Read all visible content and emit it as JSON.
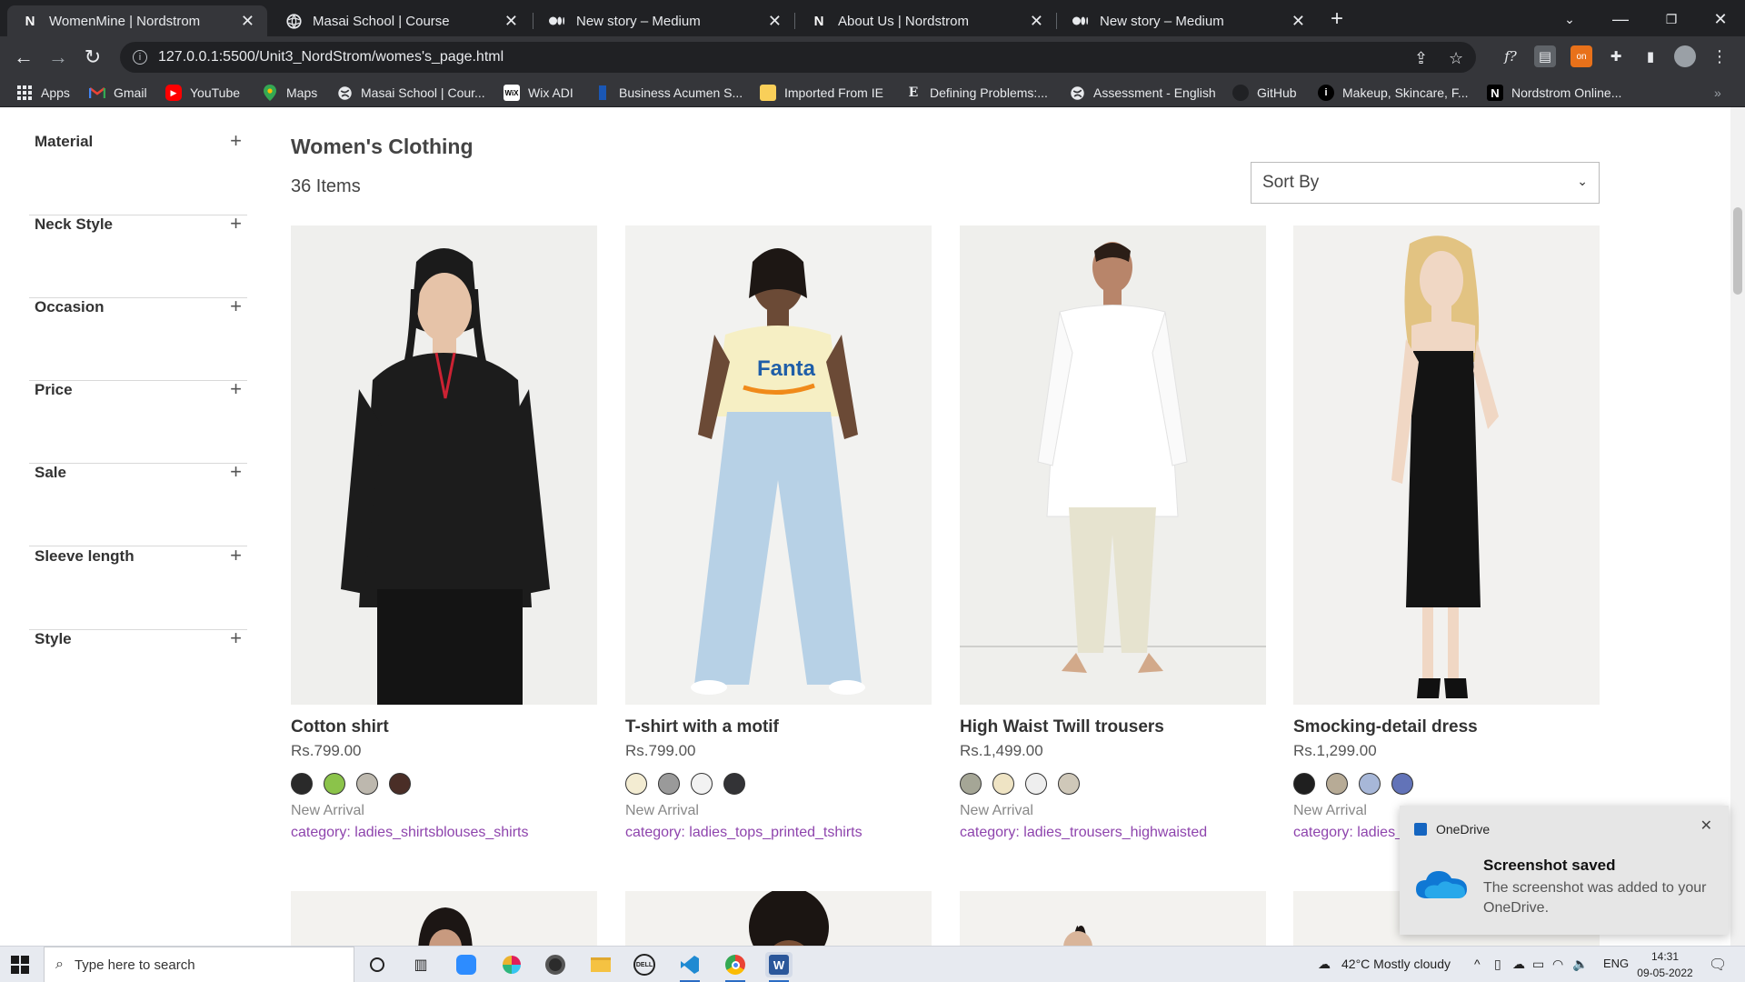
{
  "tabs": [
    {
      "title": "WomenMine | Nordstrom",
      "favicon": "N",
      "active": true
    },
    {
      "title": "Masai School | Course",
      "favicon": "globe"
    },
    {
      "title": "New story – Medium",
      "favicon": "medium"
    },
    {
      "title": "About Us | Nordstrom",
      "favicon": "N"
    },
    {
      "title": "New story – Medium",
      "favicon": "medium"
    }
  ],
  "address_bar": {
    "url": "127.0.0.1:5500/Unit3_NordStrom/womes's_page.html"
  },
  "bookmarks": [
    {
      "label": "Apps",
      "icon": "apps-grid-icon"
    },
    {
      "label": "Gmail",
      "icon": "gmail-icon"
    },
    {
      "label": "YouTube",
      "icon": "youtube-icon"
    },
    {
      "label": "Maps",
      "icon": "maps-icon"
    },
    {
      "label": "Masai School | Cour...",
      "icon": "globe-icon"
    },
    {
      "label": "Wix ADI",
      "icon": "wix-icon"
    },
    {
      "label": "Business Acumen S...",
      "icon": "bookmark-icon"
    },
    {
      "label": "Imported From IE",
      "icon": "folder-icon"
    },
    {
      "label": "Defining Problems:...",
      "icon": "e-icon"
    },
    {
      "label": "Assessment - English",
      "icon": "globe-icon"
    },
    {
      "label": "GitHub",
      "icon": "github-icon"
    },
    {
      "label": "Makeup, Skincare, F...",
      "icon": "info-icon"
    },
    {
      "label": "Nordstrom Online...",
      "icon": "nordstrom-icon"
    }
  ],
  "sidebar": {
    "filters": [
      {
        "label": "Material"
      },
      {
        "label": "Neck Style"
      },
      {
        "label": "Occasion"
      },
      {
        "label": "Price"
      },
      {
        "label": "Sale"
      },
      {
        "label": "Sleeve length"
      },
      {
        "label": "Style"
      }
    ],
    "expand_symbol": "+"
  },
  "main": {
    "title": "Women's Clothing",
    "count": "36 Items",
    "sort": {
      "selected": "Sort By"
    }
  },
  "products": [
    {
      "name": "Cotton shirt",
      "price": "Rs.799.00",
      "badge": "New Arrival",
      "category": "category: ladies_shirtsblouses_shirts",
      "swatches": [
        "#2a2a2a",
        "#8bc34a",
        "#bdb8ae",
        "#4a2e27"
      ]
    },
    {
      "name": "T-shirt with a motif",
      "price": "Rs.799.00",
      "badge": "New Arrival",
      "category": "category: ladies_tops_printed_tshirts",
      "swatches": [
        "#f3ecd2",
        "#9a9a9a",
        "#f2f2f2",
        "#333336"
      ]
    },
    {
      "name": "High Waist Twill trousers",
      "price": "Rs.1,499.00",
      "badge": "New Arrival",
      "category": "category: ladies_trousers_highwaisted",
      "swatches": [
        "#a5a696",
        "#efe4c4",
        "#eeeeee",
        "#cfc8b9"
      ]
    },
    {
      "name": "Smocking-detail dress",
      "price": "Rs.1,299.00",
      "badge": "New Arrival",
      "category": "category: ladies_dresses_smocking",
      "swatches": [
        "#1f1f1f",
        "#b7ab96",
        "#a7b7d8",
        "#6273b8"
      ]
    }
  ],
  "toast": {
    "app": "OneDrive",
    "title": "Screenshot saved",
    "body": "The screenshot was added to your OneDrive."
  },
  "taskbar": {
    "search_placeholder": "Type here to search",
    "weather": "42°C  Mostly cloudy",
    "language": "ENG",
    "time": "14:31",
    "date": "09-05-2022"
  },
  "colors": {
    "category_link": "#8e44ad",
    "chrome_dark": "#202124",
    "chrome_mid": "#35363a"
  }
}
